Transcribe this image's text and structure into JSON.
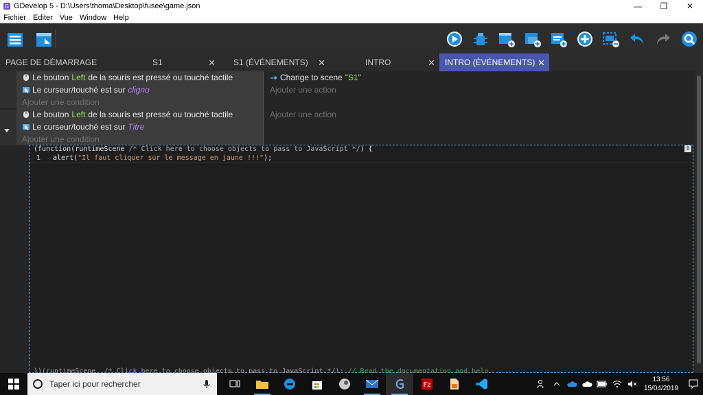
{
  "window": {
    "title": "GDevelop 5 - D:\\Users\\thoma\\Desktop\\fusee\\game.json",
    "minimize": "—",
    "restore": "❐",
    "close": "✕"
  },
  "menu": [
    "Fichier",
    "Editer",
    "Vue",
    "Window",
    "Help"
  ],
  "tabs": [
    {
      "label": "PAGE DE DÉMARRAGE",
      "closable": false
    },
    {
      "label": "S1",
      "closable": true
    },
    {
      "label": "S1 (ÉVÉNEMENTS)",
      "closable": true
    },
    {
      "label": "INTRO",
      "closable": true
    },
    {
      "label": "INTRO (ÉVÉNEMENTS)",
      "closable": true,
      "active": true
    }
  ],
  "tab_close_glyph": "✕",
  "events": [
    {
      "conditions": [
        {
          "prefix": "Le bouton",
          "highlight": "Left",
          "suffix": "de la souris est pressé ou touché tactile",
          "icon": "mouse-icon"
        },
        {
          "prefix": "Le curseur/touché est sur",
          "object": "cligno",
          "icon": "cursor-on-object-icon"
        }
      ],
      "add_condition": "Ajouter une condition",
      "actions": [
        {
          "prefix": "Change to scene",
          "highlight": "\"S1\"",
          "icon": "scene-change-icon"
        }
      ],
      "add_action": "Ajouter une action"
    },
    {
      "conditions": [
        {
          "prefix": "Le bouton",
          "highlight": "Left",
          "suffix": "de la souris est pressé ou touché tactile",
          "icon": "mouse-icon"
        },
        {
          "prefix": "Le curseur/touché est sur",
          "object": "Titre",
          "icon": "cursor-on-object-icon"
        }
      ],
      "add_condition": "Ajouter une condition",
      "add_action": "Ajouter une action"
    }
  ],
  "js_event": {
    "header_code": "(function(runtimeScene ",
    "header_comment": "/* Click here to choose objects to pass to JavaScript */",
    "header_end": ") {",
    "line_number": "1",
    "code_prefix": "alert(",
    "code_string": "\"Il faut cliquer sur le message en jaune !!!\"",
    "code_suffix": ");",
    "footer_code": "})(runtimeScene, /* Click here to choose objects to pass to JavaScript */); ",
    "footer_comment": "// Read the documentation and help",
    "toggle": "⇕"
  },
  "taskbar": {
    "search_placeholder": "Taper ici pour rechercher",
    "time": "13:56",
    "date": "15/04/2019"
  },
  "colors": {
    "accent_tab": "#4a56ad",
    "highlight_green": "#9ae65a",
    "highlight_purple": "#b886f3",
    "play_blue": "#1f8fe0"
  }
}
